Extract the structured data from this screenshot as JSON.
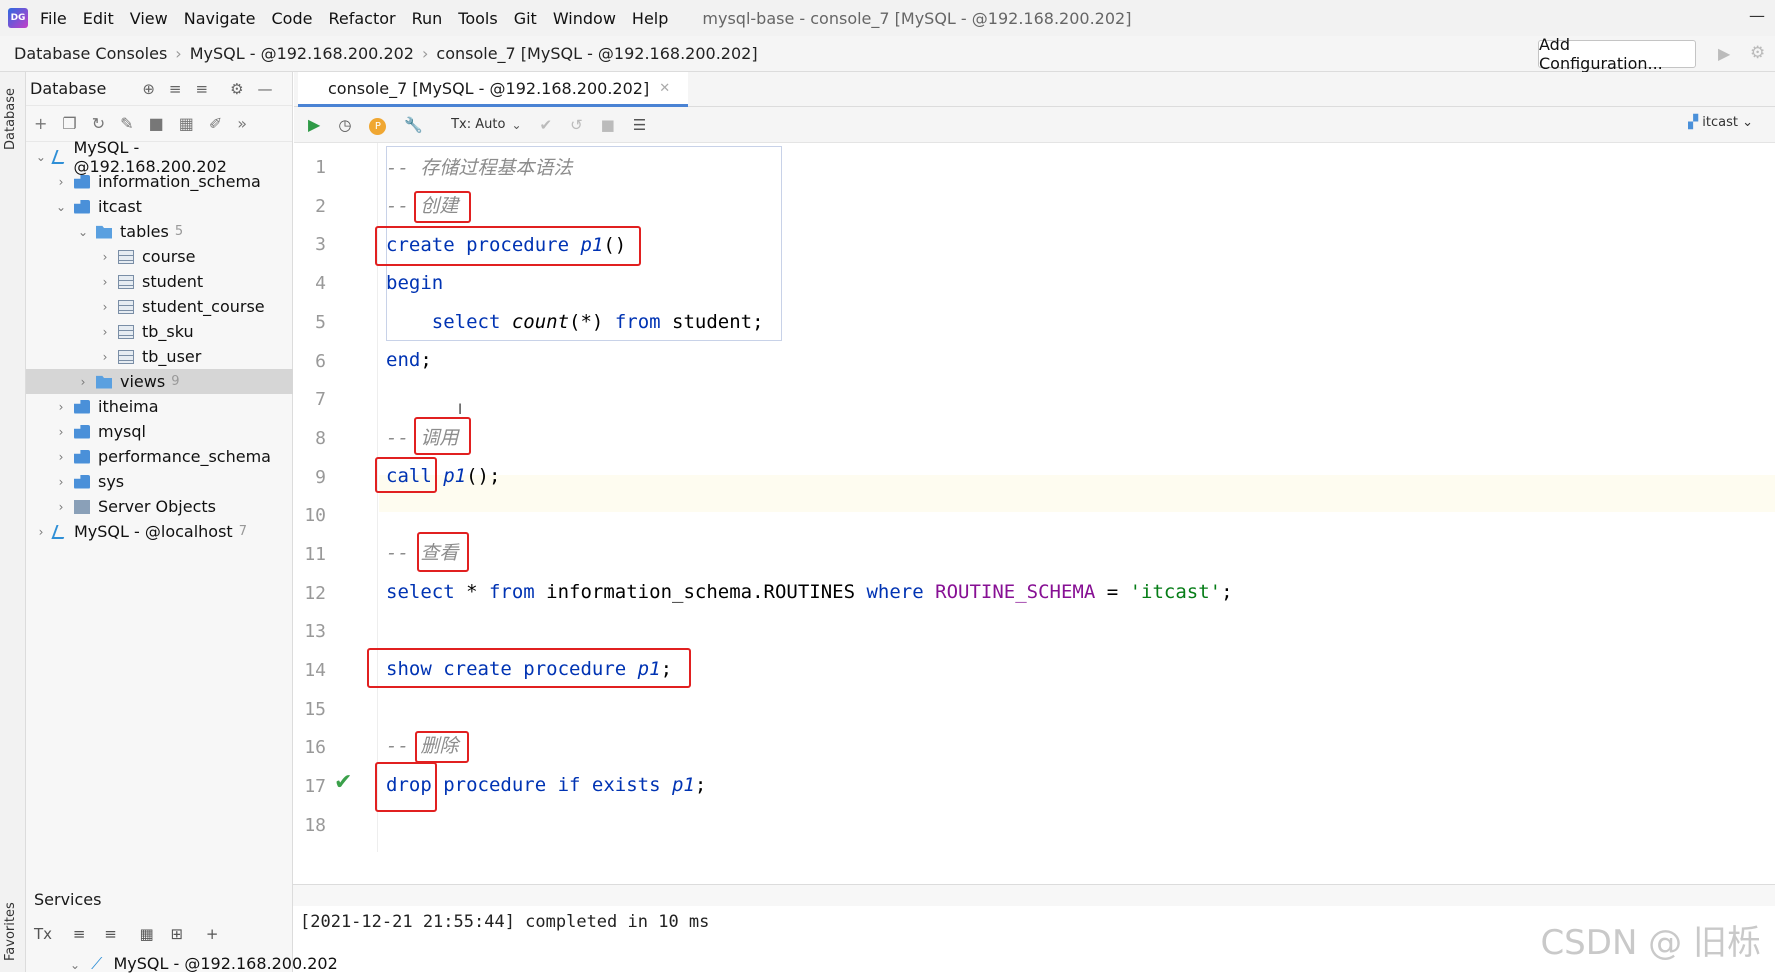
{
  "menubar": {
    "items": [
      "File",
      "Edit",
      "View",
      "Navigate",
      "Code",
      "Refactor",
      "Run",
      "Tools",
      "Git",
      "Window",
      "Help"
    ],
    "window_title": "mysql-base - console_7 [MySQL - @192.168.200.202]"
  },
  "navbar": {
    "crumbs": [
      "Database Consoles",
      "MySQL - @192.168.200.202",
      "console_7 [MySQL - @192.168.200.202]"
    ],
    "add_configuration": "Add Configuration..."
  },
  "left_strip": {
    "database": "Database",
    "favorites": "Favorites"
  },
  "db_panel": {
    "title": "Database",
    "tree": [
      {
        "label": "MySQL - @192.168.200.202",
        "count": ""
      },
      {
        "label": "information_schema",
        "count": ""
      },
      {
        "label": "itcast",
        "count": ""
      },
      {
        "label": "tables",
        "count": "5"
      },
      {
        "label": "course",
        "count": ""
      },
      {
        "label": "student",
        "count": ""
      },
      {
        "label": "student_course",
        "count": ""
      },
      {
        "label": "tb_sku",
        "count": ""
      },
      {
        "label": "tb_user",
        "count": ""
      },
      {
        "label": "views",
        "count": "9"
      },
      {
        "label": "itheima",
        "count": ""
      },
      {
        "label": "mysql",
        "count": ""
      },
      {
        "label": "performance_schema",
        "count": ""
      },
      {
        "label": "sys",
        "count": ""
      },
      {
        "label": "Server Objects",
        "count": ""
      },
      {
        "label": "MySQL - @localhost",
        "count": "7"
      }
    ]
  },
  "editor": {
    "tab_label": "console_7 [MySQL - @192.168.200.202]",
    "tx_mode": "Tx: Auto",
    "schema": "itcast",
    "line_numbers": [
      "1",
      "2",
      "3",
      "4",
      "5",
      "6",
      "7",
      "8",
      "9",
      "10",
      "11",
      "12",
      "13",
      "14",
      "15",
      "16",
      "17",
      "18"
    ],
    "code": {
      "l1": "-- 存储过程基本语法",
      "l2_dash": "-- ",
      "l2_c": "创建",
      "l3_a": "create procedure ",
      "l3_b": "p1",
      "l3_c": "()",
      "l4": "begin",
      "l5_a": "    select ",
      "l5_b": "count",
      "l5_c": "(*) ",
      "l5_d": "from",
      "l5_e": " student;",
      "l6_a": "end",
      "l6_b": ";",
      "l8_dash": "-- ",
      "l8_c": "调用",
      "l9_a": "call ",
      "l9_b": "p1",
      "l9_c": "();",
      "l11_dash": "-- ",
      "l11_c": "查看",
      "l12_a": "select",
      "l12_b": " * ",
      "l12_c": "from",
      "l12_d": " information_schema.ROUTINES ",
      "l12_e": "where",
      "l12_f": " ",
      "l12_g": "ROUTINE_SCHEMA",
      "l12_h": " = ",
      "l12_i": "'itcast'",
      "l12_j": ";",
      "l14_a": "show create procedure ",
      "l14_b": "p1",
      "l14_c": ";",
      "l16_dash": "-- ",
      "l16_c": "删除",
      "l17_a": "drop",
      "l17_b": " procedure if exists ",
      "l17_c": "p1",
      "l17_d": ";"
    }
  },
  "services": {
    "title": "Services",
    "tx": "Tx",
    "connection": "MySQL - @192.168.200.202",
    "output": "[2021-12-21 21:55:44] completed in 10 ms"
  },
  "watermark": "CSDN @ 旧栎"
}
